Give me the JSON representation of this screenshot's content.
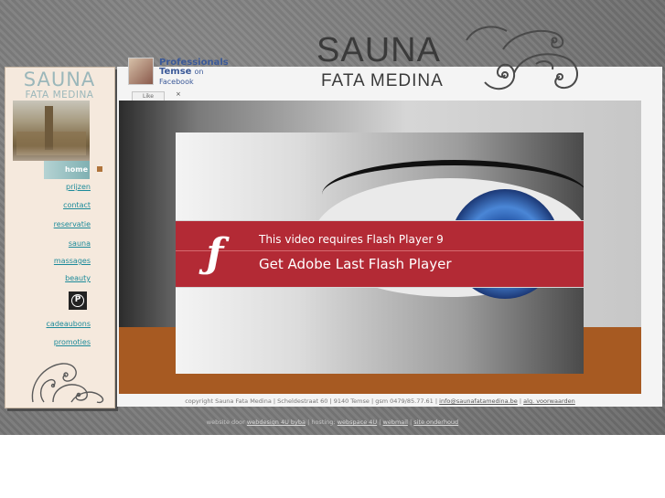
{
  "brand": {
    "line1": "SAUNA",
    "line2": "FATA MEDINA"
  },
  "sidebar": {
    "logo_line1": "SAUNA",
    "logo_line2": "FATA MEDINA",
    "items": [
      {
        "label": "home"
      },
      {
        "label": "prijzen"
      },
      {
        "label": "contact"
      },
      {
        "label": "reservatie"
      },
      {
        "label": "sauna"
      },
      {
        "label": "massages"
      },
      {
        "label": "beauty"
      },
      {
        "label": "cadeaubons"
      },
      {
        "label": "promoties"
      }
    ],
    "pinterest_glyph": "P"
  },
  "facebook": {
    "name1": "Professionals",
    "name2": "Temse",
    "on": "on",
    "site": "Facebook",
    "like": "Like"
  },
  "flash": {
    "message": "This video requires Flash Player 9",
    "cta": "Get Adobe Last Flash Player"
  },
  "footer": {
    "copyright": "copyright Sauna Fata Medina | Scheldestraat 60 | 9140 Temse | gsm 0479/85.77.61 |",
    "email": "info@saunafatamedina.be",
    "sep": "|",
    "terms": "alg. voorwaarden",
    "credits_prefix": "website door",
    "design": "webdesign 4U byba",
    "hosting_prefix": "| hosting:",
    "hosting": "webspace 4U",
    "webmail": "webmail",
    "support": "site onderhoud"
  },
  "colors": {
    "accent": "#1c8a9a",
    "flash_red": "#b32a35",
    "rust": "#a75a22"
  }
}
